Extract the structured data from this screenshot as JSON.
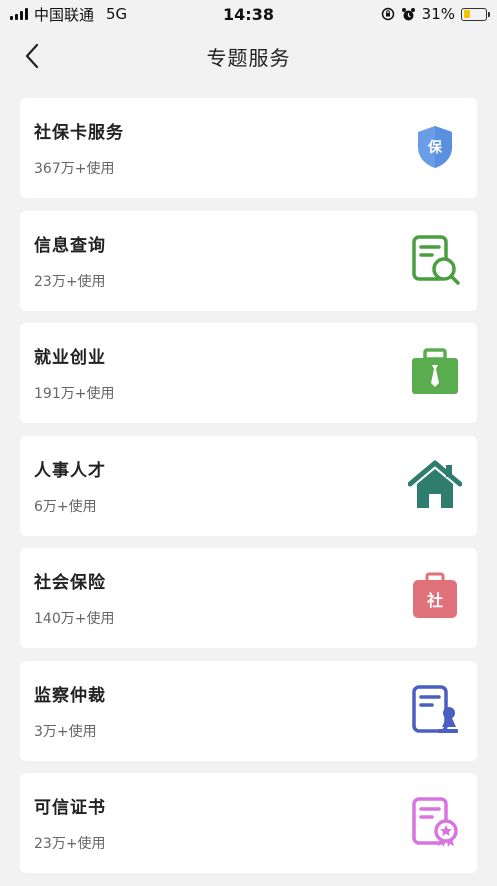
{
  "status": {
    "carrier": "中国联通",
    "network": "5G",
    "time": "14:38",
    "battery": "31%",
    "battery_level": 0.31
  },
  "nav": {
    "title": "专题服务"
  },
  "services": [
    {
      "title": "社保卡服务",
      "usage": "367万+使用",
      "icon": "shield-bao-icon",
      "color": "#5b8fe0"
    },
    {
      "title": "信息查询",
      "usage": "23万+使用",
      "icon": "document-search-icon",
      "color": "#4a9e3f"
    },
    {
      "title": "就业创业",
      "usage": "191万+使用",
      "icon": "briefcase-icon",
      "color": "#5aad4e"
    },
    {
      "title": "人事人才",
      "usage": "6万+使用",
      "icon": "house-icon",
      "color": "#2e7d6f"
    },
    {
      "title": "社会保险",
      "usage": "140万+使用",
      "icon": "medical-kit-icon",
      "color": "#e0707a"
    },
    {
      "title": "监察仲裁",
      "usage": "3万+使用",
      "icon": "document-stamp-icon",
      "color": "#4a5fc1"
    },
    {
      "title": "可信证书",
      "usage": "23万+使用",
      "icon": "certificate-icon",
      "color": "#d873e0"
    }
  ]
}
